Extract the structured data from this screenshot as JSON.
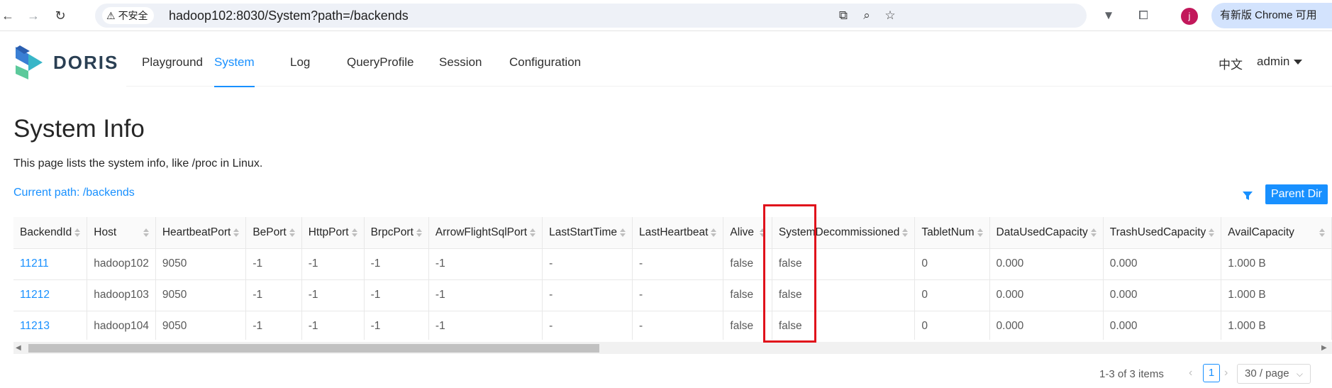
{
  "browser": {
    "security_label": "不安全",
    "url": "hadoop102:8030/System?path=/backends",
    "profile_initial": "j",
    "update_label": "有新版 Chrome 可用"
  },
  "app": {
    "brand": "DORIS",
    "nav": [
      {
        "label": "Playground",
        "active": false
      },
      {
        "label": "System",
        "active": true
      },
      {
        "label": "Log",
        "active": false
      },
      {
        "label": "QueryProfile",
        "active": false
      },
      {
        "label": "Session",
        "active": false
      },
      {
        "label": "Configuration",
        "active": false
      }
    ],
    "language": "中文",
    "user": "admin"
  },
  "page": {
    "title": "System Info",
    "description": "This page lists the system info, like /proc in Linux.",
    "current_path": "Current path: /backends",
    "parent_dir_label": "Parent Dir"
  },
  "table": {
    "columns": [
      "BackendId",
      "Host",
      "HeartbeatPort",
      "BePort",
      "HttpPort",
      "BrpcPort",
      "ArrowFlightSqlPort",
      "LastStartTime",
      "LastHeartbeat",
      "Alive",
      "SystemDecommissioned",
      "TabletNum",
      "DataUsedCapacity",
      "TrashUsedCapacity",
      "AvailCapacity"
    ],
    "rows": [
      [
        "11211",
        "hadoop102",
        "9050",
        "-1",
        "-1",
        "-1",
        "-1",
        "-",
        "-",
        "false",
        "false",
        "0",
        "0.000",
        "0.000",
        "1.000 B"
      ],
      [
        "11212",
        "hadoop103",
        "9050",
        "-1",
        "-1",
        "-1",
        "-1",
        "-",
        "-",
        "false",
        "false",
        "0",
        "0.000",
        "0.000",
        "1.000 B"
      ],
      [
        "11213",
        "hadoop104",
        "9050",
        "-1",
        "-1",
        "-1",
        "-1",
        "-",
        "-",
        "false",
        "false",
        "0",
        "0.000",
        "0.000",
        "1.000 B"
      ]
    ]
  },
  "pagination": {
    "total_text": "1-3 of 3 items",
    "current_page": "1",
    "page_size": "30 / page"
  },
  "colors": {
    "primary": "#1890ff",
    "highlight": "#e0111b"
  }
}
